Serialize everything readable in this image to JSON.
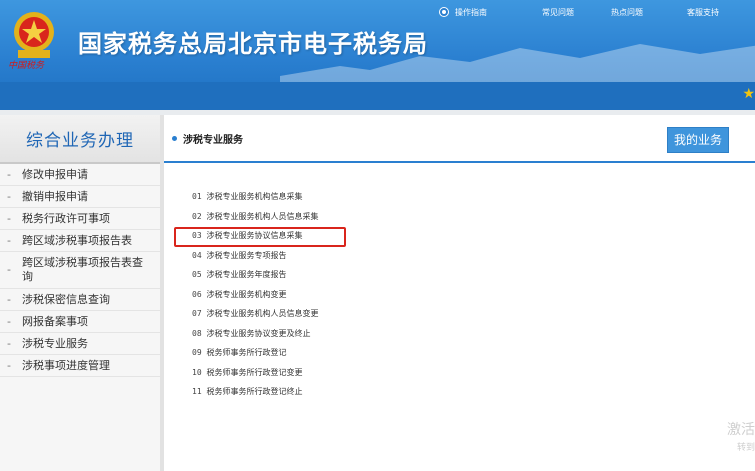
{
  "header": {
    "emblem_caption": "中国税务",
    "site_title": "国家税务总局北京市电子税务局",
    "nav": [
      "操作指南",
      "常见问题",
      "热点问题",
      "客服支持"
    ]
  },
  "sidebar": {
    "title": "综合业务办理",
    "items": [
      "修改申报申请",
      "撤销申报申请",
      "税务行政许可事项",
      "跨区域涉税事项报告表",
      "跨区域涉税事项报告表查询",
      "涉税保密信息查询",
      "网报备案事项",
      "涉税专业服务",
      "涉税事项进度管理"
    ]
  },
  "main": {
    "section_title": "涉税专业服务",
    "my_business_label": "我的业务",
    "list": [
      {
        "num": "01",
        "label": "涉税专业服务机构信息采集"
      },
      {
        "num": "02",
        "label": "涉税专业服务机构人员信息采集"
      },
      {
        "num": "03",
        "label": "涉税专业服务协议信息采集"
      },
      {
        "num": "04",
        "label": "涉税专业服务专项报告"
      },
      {
        "num": "05",
        "label": "涉税专业服务年度报告"
      },
      {
        "num": "06",
        "label": "涉税专业服务机构变更"
      },
      {
        "num": "07",
        "label": "涉税专业服务机构人员信息变更"
      },
      {
        "num": "08",
        "label": "涉税专业服务协议变更及终止"
      },
      {
        "num": "09",
        "label": "税务师事务所行政登记"
      },
      {
        "num": "10",
        "label": "税务师事务所行政登记变更"
      },
      {
        "num": "11",
        "label": "税务师事务所行政登记终止"
      }
    ]
  },
  "watermark": {
    "line1": "激活",
    "line2": "转到"
  },
  "colors": {
    "brand_blue": "#2a7fd0",
    "highlight_red": "#d9251c",
    "sidebar_title": "#1f66b5"
  }
}
